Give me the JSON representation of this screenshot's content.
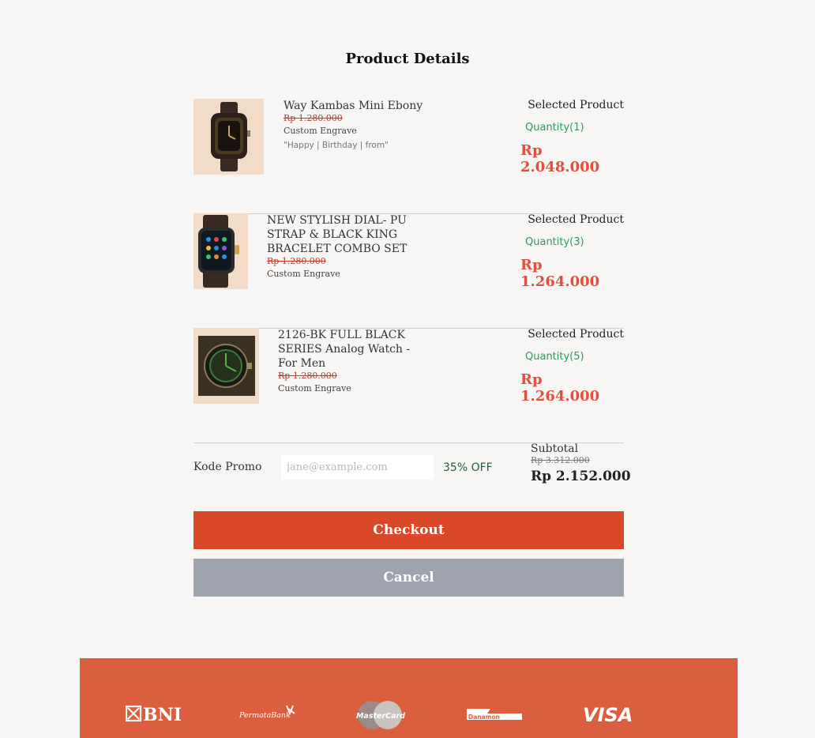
{
  "page": {
    "title": "Product Details"
  },
  "products": [
    {
      "name": "Way Kambas Mini Ebony",
      "old_price": "Rp 1.280.000",
      "engrave_label": "Custom Engrave",
      "engrave_text": "\"Happy | Birthday | from\"",
      "selected_label": "Selected Product",
      "quantity": "Quantity(1)",
      "price": "Rp 2.048.000"
    },
    {
      "name": "NEW STYLISH DIAL- PU STRAP & BLACK KING BRACELET COMBO SET",
      "old_price": "Rp 1.280.000",
      "engrave_label": "Custom Engrave",
      "selected_label": "Selected Product",
      "quantity": "Quantity(3)",
      "price": "Rp 1.264.000"
    },
    {
      "name": "2126-BK FULL BLACK SERIES Analog Watch - For Men",
      "old_price": "Rp 1.280.000",
      "engrave_label": "Custom Engrave",
      "selected_label": "Selected Product",
      "quantity": "Quantity(5)",
      "price": "Rp 1.264.000"
    }
  ],
  "promo": {
    "label": "Kode Promo",
    "value": "",
    "placeholder": "jane@example.com",
    "discount": "35% OFF"
  },
  "subtotal": {
    "label": "Subtotal",
    "old": "Rp 3.312.000",
    "total": "Rp 2.152.000"
  },
  "buttons": {
    "checkout": "Checkout",
    "cancel": "Cancel"
  },
  "footer": {
    "logos": [
      {
        "name": "bni-logo",
        "text": "BNI"
      },
      {
        "name": "permata-bank-logo",
        "text": "PermataBank"
      },
      {
        "name": "mastercard-logo",
        "text": "MasterCard"
      },
      {
        "name": "danamon-logo",
        "text": "Danamon"
      },
      {
        "name": "visa-logo",
        "text": "VISA"
      }
    ]
  },
  "colors": {
    "background": "#f7f6f4",
    "accent": "#d94828",
    "price": "#e24f41",
    "quantity": "#2a9a5f",
    "cancel": "#9ea3ad",
    "footer": "#db5f3f"
  }
}
